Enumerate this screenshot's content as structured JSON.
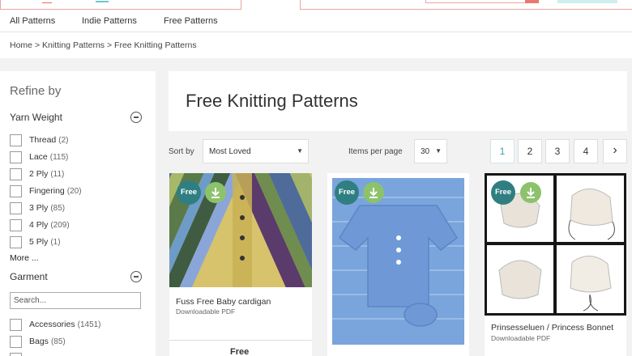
{
  "nav": {
    "items": [
      "All Patterns",
      "Indie Patterns",
      "Free Patterns"
    ]
  },
  "breadcrumb": {
    "items": [
      "Home",
      "Knitting Patterns",
      "Free Knitting Patterns"
    ],
    "separator": ">"
  },
  "sidebar": {
    "title": "Refine by",
    "yarn_weight": {
      "heading": "Yarn Weight",
      "options": [
        {
          "label": "Thread",
          "count": "(2)"
        },
        {
          "label": "Lace",
          "count": "(115)"
        },
        {
          "label": "2 Ply",
          "count": "(11)"
        },
        {
          "label": "Fingering",
          "count": "(20)"
        },
        {
          "label": "3 Ply",
          "count": "(85)"
        },
        {
          "label": "4 Ply",
          "count": "(209)"
        },
        {
          "label": "5 Ply",
          "count": "(1)"
        }
      ],
      "more_label": "More ..."
    },
    "garment": {
      "heading": "Garment",
      "search_placeholder": "Search...",
      "options": [
        {
          "label": "Accessories",
          "count": "(1451)"
        },
        {
          "label": "Bags",
          "count": "(85)"
        }
      ]
    }
  },
  "main": {
    "title": "Free Knitting Patterns",
    "sort_label": "Sort by",
    "sort_value": "Most Loved",
    "items_per_page_label": "Items per page",
    "items_per_page_value": "30",
    "pagination": [
      "1",
      "2",
      "3",
      "4"
    ],
    "pagination_next": "›",
    "active_page": "1"
  },
  "products": [
    {
      "badge": "Free",
      "name": "Fuss Free Baby cardigan",
      "type": "Downloadable PDF",
      "price": "Free"
    },
    {
      "badge": "Free",
      "name": "",
      "type": "",
      "price": ""
    },
    {
      "badge": "Free",
      "name": "Prinsesseluen / Princess Bonnet",
      "type": "Downloadable PDF",
      "price": ""
    }
  ],
  "colors": {
    "free_badge": "#2f7f82",
    "download_badge": "#8cc26b",
    "active_page": "#3a9bb0",
    "brand_coral": "#e9786f"
  }
}
